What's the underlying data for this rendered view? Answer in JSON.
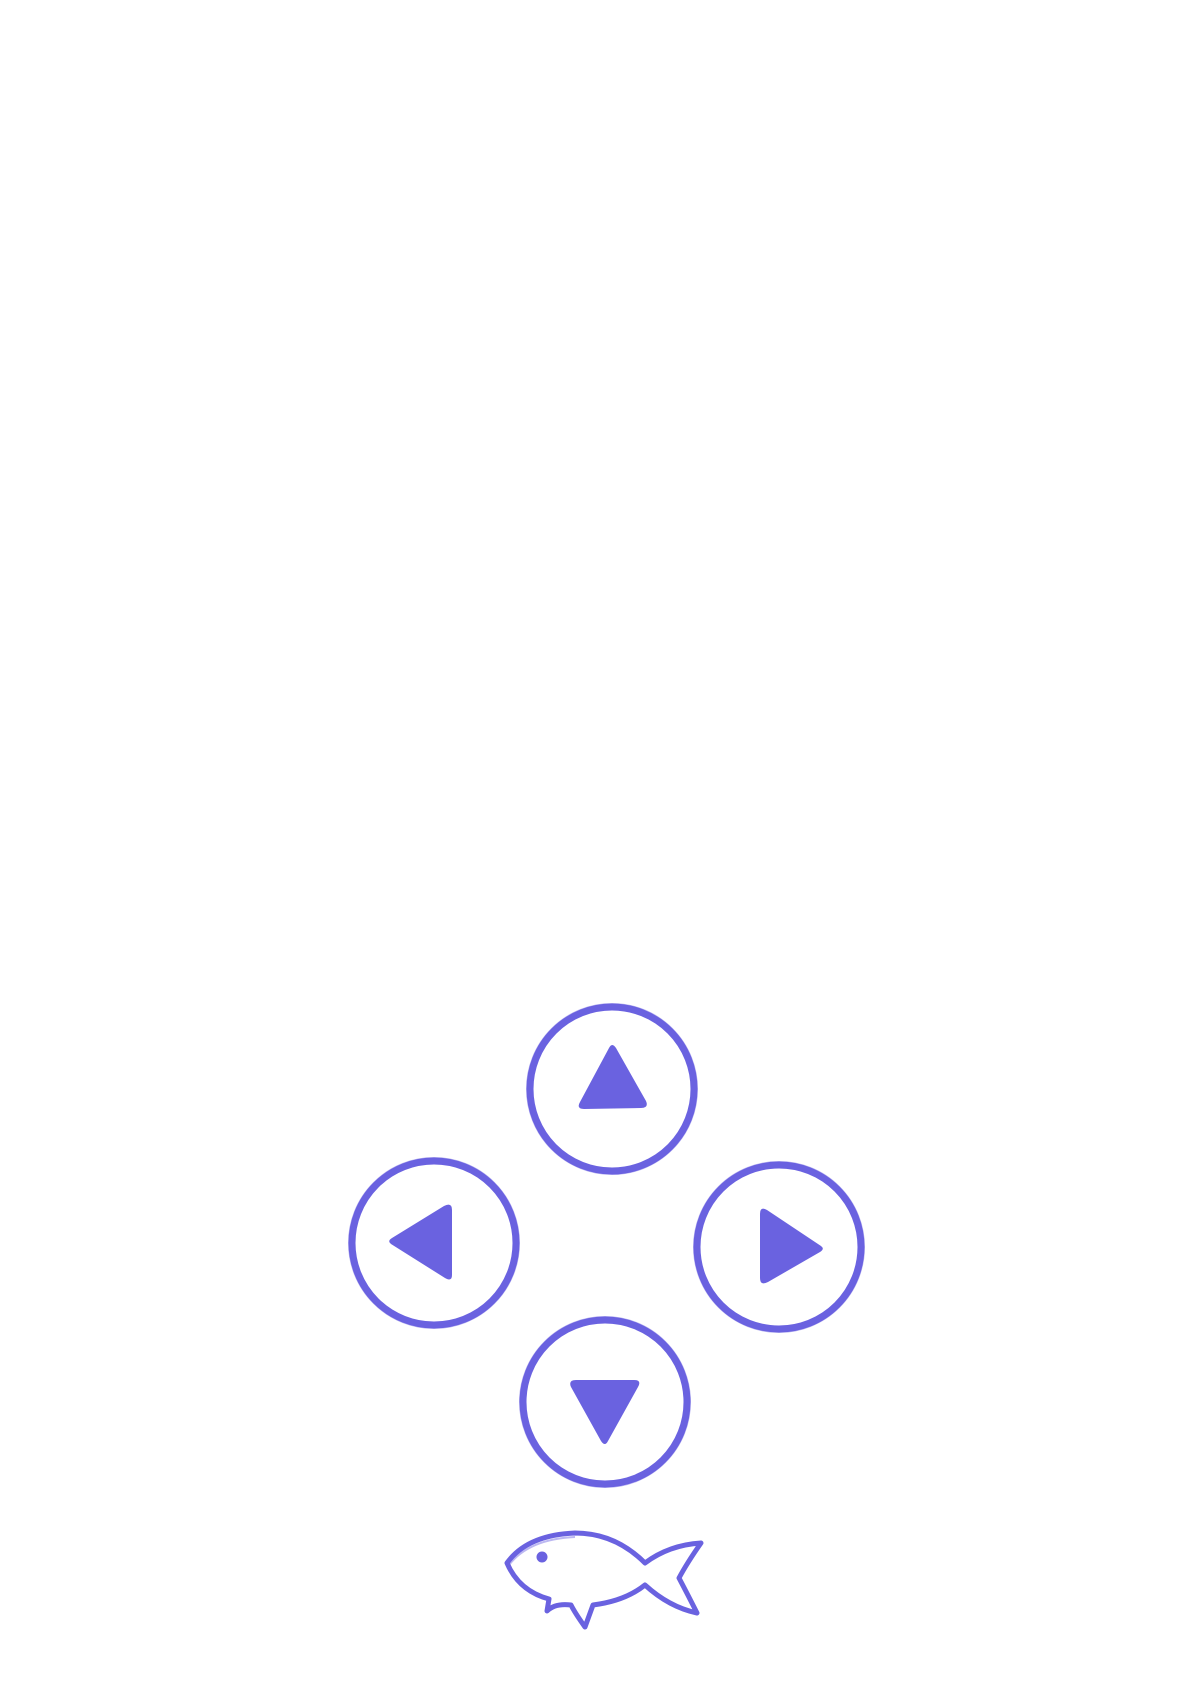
{
  "controls": {
    "up": {
      "icon": "arrow-up-icon"
    },
    "left": {
      "icon": "arrow-left-icon"
    },
    "right": {
      "icon": "arrow-right-icon"
    },
    "down": {
      "icon": "arrow-down-icon"
    }
  },
  "logo": {
    "icon": "fish-icon"
  },
  "colors": {
    "accent": "#6a62e0",
    "background": "#ffffff"
  }
}
